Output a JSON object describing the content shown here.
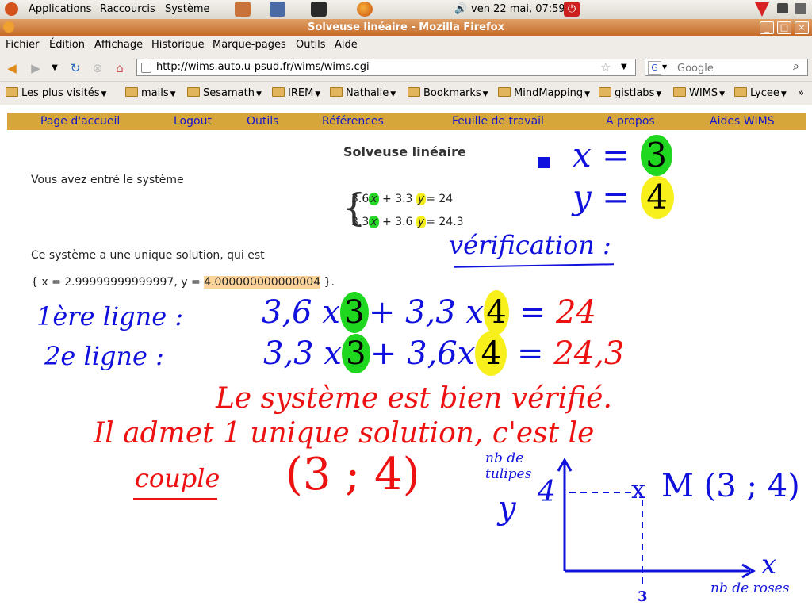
{
  "panel": {
    "applications": "Applications",
    "shortcuts": "Raccourcis",
    "system": "Système",
    "datetime": "ven 22 mai, 07:59"
  },
  "window": {
    "title": "Solveuse linéaire - Mozilla Firefox"
  },
  "menu": {
    "file": "Fichier",
    "edit": "Édition",
    "view": "Affichage",
    "history": "Historique",
    "bookmarks": "Marque-pages",
    "tools": "Outils",
    "help": "Aide"
  },
  "nav": {
    "url": "http://wims.auto.u-psud.fr/wims/wims.cgi",
    "search_placeholder": "Google"
  },
  "bookmarks": [
    "Les plus visités",
    "mails",
    "Sesamath",
    "IREM",
    "Nathalie",
    "Bookmarks",
    "MindMapping",
    "gistlabs",
    "WIMS",
    "Lycee"
  ],
  "bookmarks_overflow": "»",
  "wims_nav": [
    "Page d'accueil",
    "Logout",
    "Outils",
    "Références",
    "Feuille de travail",
    "A propos",
    "Aides WIMS"
  ],
  "page": {
    "title": "Solveuse linéaire",
    "entered": "Vous avez entré le système",
    "eq1": {
      "c1": "3.6",
      "v1": "x",
      "op": "+ 3.3",
      "v2": "y",
      "rhs": "= 24"
    },
    "eq2": {
      "c1": "3.3",
      "v1": "x",
      "op": "+ 3.6",
      "v2": "y",
      "rhs": "= 24.3"
    },
    "unique": "Ce système a une unique solution, qui est",
    "solution_prefix": "{ x = 2.99999999999997, y =",
    "solution_y": "4.000000000000004",
    "solution_suffix": "}."
  },
  "annotations": {
    "x_eq": "x =",
    "x_val": "3",
    "y_eq": "y =",
    "y_val": "4",
    "verification": "vérification :",
    "line1_label": "1ère ligne :",
    "line1_a": "3,6 x",
    "line1_x": "3",
    "line1_b": "+ 3,3 x",
    "line1_y": "4",
    "line1_eq": "=",
    "line1_rhs": "24",
    "line2_label": "2e ligne :",
    "line2_a": "3,3 x",
    "line2_x": "3",
    "line2_b": "+ 3,6x",
    "line2_y": "4",
    "line2_eq": "=",
    "line2_rhs": "24,3",
    "verified": "Le système est bien vérifié.",
    "admits": "Il admet 1 unique solution, c'est le",
    "couple_word": "couple",
    "couple": "(3 ; 4)",
    "y_axis_label": "nb de tulipes",
    "y_axis_letter": "y",
    "y_tick": "4",
    "point_mark": "x",
    "point_label": "M (3 ; 4)",
    "x_axis_letter": "x",
    "x_axis_label": "nb de roses",
    "x_tick": "3"
  },
  "colors": {
    "annotation_blue": "#1111dd",
    "annotation_red": "#ee1111",
    "highlight_green": "#1ed71e",
    "highlight_yellow": "#f7f01d",
    "wims_nav_bg": "#d6a63b",
    "titlebar": "#c56a2a"
  }
}
